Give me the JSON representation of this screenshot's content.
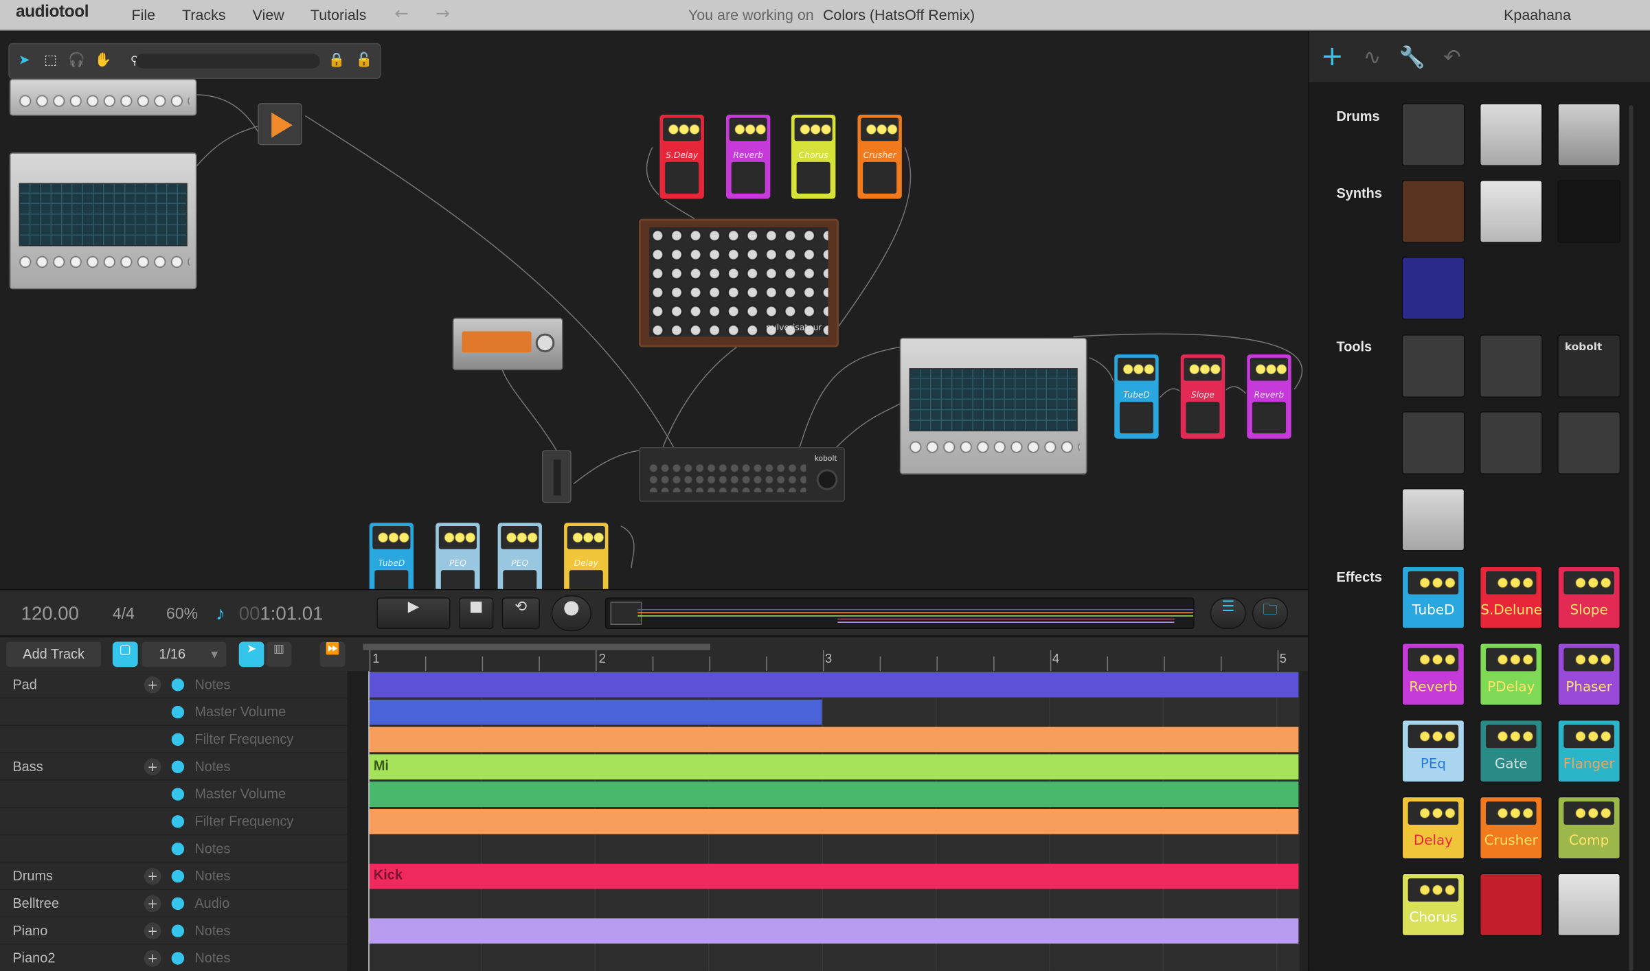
{
  "menubar": {
    "logo": "audiotool",
    "menus": [
      "File",
      "Tracks",
      "View",
      "Tutorials"
    ],
    "working_prefix": "You are working on",
    "project_name": "Colors (HatsOff Remix)",
    "user": "Kpaahana"
  },
  "desktop": {
    "toolbar_icons": [
      "pointer-icon",
      "select-rect-icon",
      "headphones-icon",
      "hand-icon",
      "zoom-icon",
      "lock-icon",
      "unlock-icon"
    ],
    "devices": [
      {
        "kind": "pedal",
        "label": "S.Delay",
        "color": "#e8263a"
      },
      {
        "kind": "pedal",
        "label": "Reverb",
        "color": "#c63ad9"
      },
      {
        "kind": "pedal",
        "label": "Chorus",
        "color": "#d6e23a"
      },
      {
        "kind": "pedal",
        "label": "Crusher",
        "color": "#f27a1e"
      },
      {
        "kind": "pedal",
        "label": "TubeD",
        "color": "#2aa7df"
      },
      {
        "kind": "pedal",
        "label": "Slope",
        "color": "#e22a55"
      },
      {
        "kind": "pedal",
        "label": "Reverb",
        "color": "#c63ad9"
      },
      {
        "kind": "pedal",
        "label": "TubeD",
        "color": "#2aa7df"
      },
      {
        "kind": "pedal",
        "label": "PEQ",
        "color": "#9ac7e0"
      },
      {
        "kind": "pedal",
        "label": "PEQ",
        "color": "#9ac7e0"
      },
      {
        "kind": "pedal",
        "label": "Delay",
        "color": "#f0c53a"
      },
      {
        "kind": "synth",
        "label": "pulverisateur"
      },
      {
        "kind": "mixer",
        "label": "kobolt"
      }
    ]
  },
  "transport": {
    "tempo": "120.00",
    "signature": "4/4",
    "zoom": "60%",
    "time_dim": "00",
    "time": "1:01.01",
    "play_icon": "play-icon",
    "stop_icon": "stop-icon",
    "loop_icon": "loop-icon",
    "record_icon": "record-icon"
  },
  "sequencer": {
    "add_track": "Add Track",
    "grid": "1/16",
    "bars": [
      "1",
      "2",
      "3",
      "4",
      "5"
    ],
    "tracks": [
      {
        "name": "Pad",
        "lanes": [
          "Notes",
          "Master Volume",
          "Filter Frequency"
        ]
      },
      {
        "name": "Bass",
        "lanes": [
          "Notes",
          "Master Volume",
          "Filter Frequency",
          "Notes"
        ]
      },
      {
        "name": "Drums",
        "lanes": [
          "Notes"
        ]
      },
      {
        "name": "Belltree",
        "lanes": [
          "Audio"
        ]
      },
      {
        "name": "Piano",
        "lanes": [
          "Notes"
        ]
      },
      {
        "name": "Piano2",
        "lanes": [
          "Notes"
        ]
      }
    ],
    "clip_labels": {
      "bass": "Mi",
      "drums": "Kick"
    },
    "colors": {
      "pad": "#5b52d8",
      "pad_vol": "#4b63d9",
      "orange": "#f79e5c",
      "bass": "#a7e35a",
      "bass_vol": "#47b86c",
      "drums": "#f02a5f",
      "piano": "#b79cf0"
    }
  },
  "browser": {
    "tab_icons": [
      "add-icon",
      "waveform-icon",
      "wrench-icon",
      "undo-icon"
    ],
    "categories": {
      "drums": "Drums",
      "synths": "Synths",
      "tools": "Tools",
      "effects": "Effects"
    },
    "effects": [
      {
        "label": "TubeD",
        "bg": "#2aa7df",
        "text": "#ffffff"
      },
      {
        "label": "S.Delune",
        "bg": "#e8263a",
        "text": "#ffe36a"
      },
      {
        "label": "Slope",
        "bg": "#e22a55",
        "text": "#ffe36a"
      },
      {
        "label": "Reverb",
        "bg": "#c63ad9",
        "text": "#ffe36a"
      },
      {
        "label": "PDelay",
        "bg": "#7ed957",
        "text": "#ffe36a"
      },
      {
        "label": "Phaser",
        "bg": "#9a4ad9",
        "text": "#ffe36a"
      },
      {
        "label": "PEq",
        "bg": "#a9d6ee",
        "text": "#2a7ad9"
      },
      {
        "label": "Gate",
        "bg": "#2a8a86",
        "text": "#cde0e0"
      },
      {
        "label": "Flanger",
        "bg": "#2ab5c9",
        "text": "#f2a55a"
      },
      {
        "label": "Delay",
        "bg": "#f0c53a",
        "text": "#e8263a"
      },
      {
        "label": "Crusher",
        "bg": "#f27a1e",
        "text": "#ffe36a"
      },
      {
        "label": "Comp",
        "bg": "#9db84a",
        "text": "#ffe36a"
      },
      {
        "label": "Chorus",
        "bg": "#d9e05a",
        "text": "#ffffff"
      }
    ],
    "tools_label": "kobolt"
  }
}
